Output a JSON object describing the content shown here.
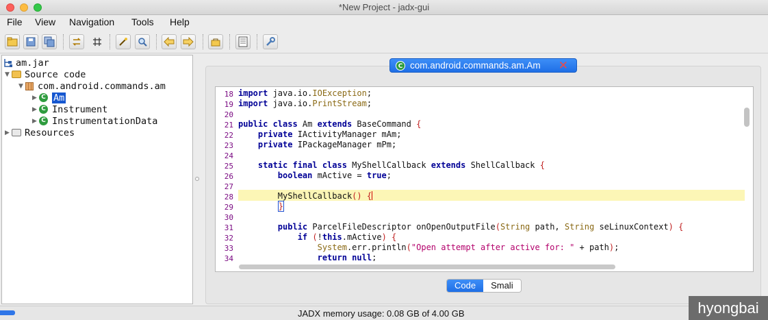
{
  "window": {
    "title": "*New Project - jadx-gui"
  },
  "menu": {
    "file": "File",
    "view": "View",
    "navigation": "Navigation",
    "tools": "Tools",
    "help": "Help"
  },
  "tree": {
    "root": "am.jar",
    "source_code": "Source code",
    "package": "com.android.commands.am",
    "classes": [
      "Am",
      "Instrument",
      "InstrumentationData"
    ],
    "resources": "Resources"
  },
  "tab": {
    "label": "com.android.commands.am.Am"
  },
  "code": {
    "line_numbers": [
      "18",
      "19",
      "20",
      "21",
      "22",
      "23",
      "24",
      "25",
      "26",
      "27",
      "28",
      "29",
      "30",
      "31",
      "32",
      "33",
      "34"
    ],
    "highlighted_line": "28"
  },
  "view_toggle": {
    "code": "Code",
    "smali": "Smali",
    "active": "Code"
  },
  "status": {
    "memory": "JADX memory usage: 0.08 GB of 4.00 GB"
  },
  "watermark": "hyongbai",
  "colors": {
    "accent": "#1f6fe6",
    "keyword": "#000096",
    "type": "#8a6914",
    "string": "#b3006b",
    "line_number": "#7a0a82",
    "highlight": "#fcf6b6"
  },
  "icons": [
    "open-icon",
    "save-icon",
    "save-all-icon",
    "sync-icon",
    "flatten-icon",
    "decompile-icon",
    "search-icon",
    "back-icon",
    "forward-icon",
    "deobfuscate-icon",
    "log-icon",
    "preferences-icon"
  ]
}
